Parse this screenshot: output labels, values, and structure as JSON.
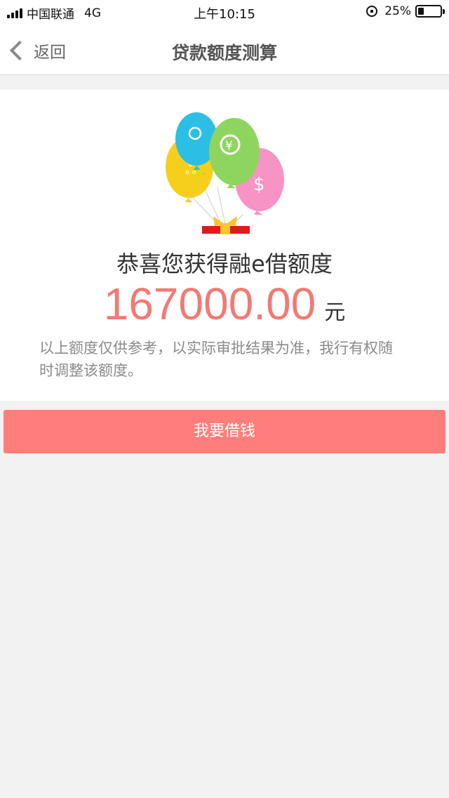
{
  "status_bar": {
    "carrier": "中国联通",
    "network": "4G",
    "time": "上午10:15",
    "battery": "25%"
  },
  "nav": {
    "back_label": "返回",
    "title": "贷款额度测算"
  },
  "result": {
    "headline": "恭喜您获得融e借额度",
    "amount": "167000.00",
    "unit": "元",
    "disclaimer": "以上额度仅供参考，以实际审批结果为准，我行有权随时调整该额度。"
  },
  "actions": {
    "borrow_label": "我要借钱"
  },
  "colors": {
    "accent": "#ff7e7b",
    "amount": "#f27a74",
    "balloon_blue": "#2bbfe6",
    "balloon_green": "#8ed55f",
    "balloon_yellow": "#f5cf1c",
    "balloon_pink": "#f793c5"
  },
  "icons": [
    "signal-icon",
    "chevron-left-icon",
    "rotation-lock-icon",
    "battery-icon",
    "balloons-illustration"
  ]
}
